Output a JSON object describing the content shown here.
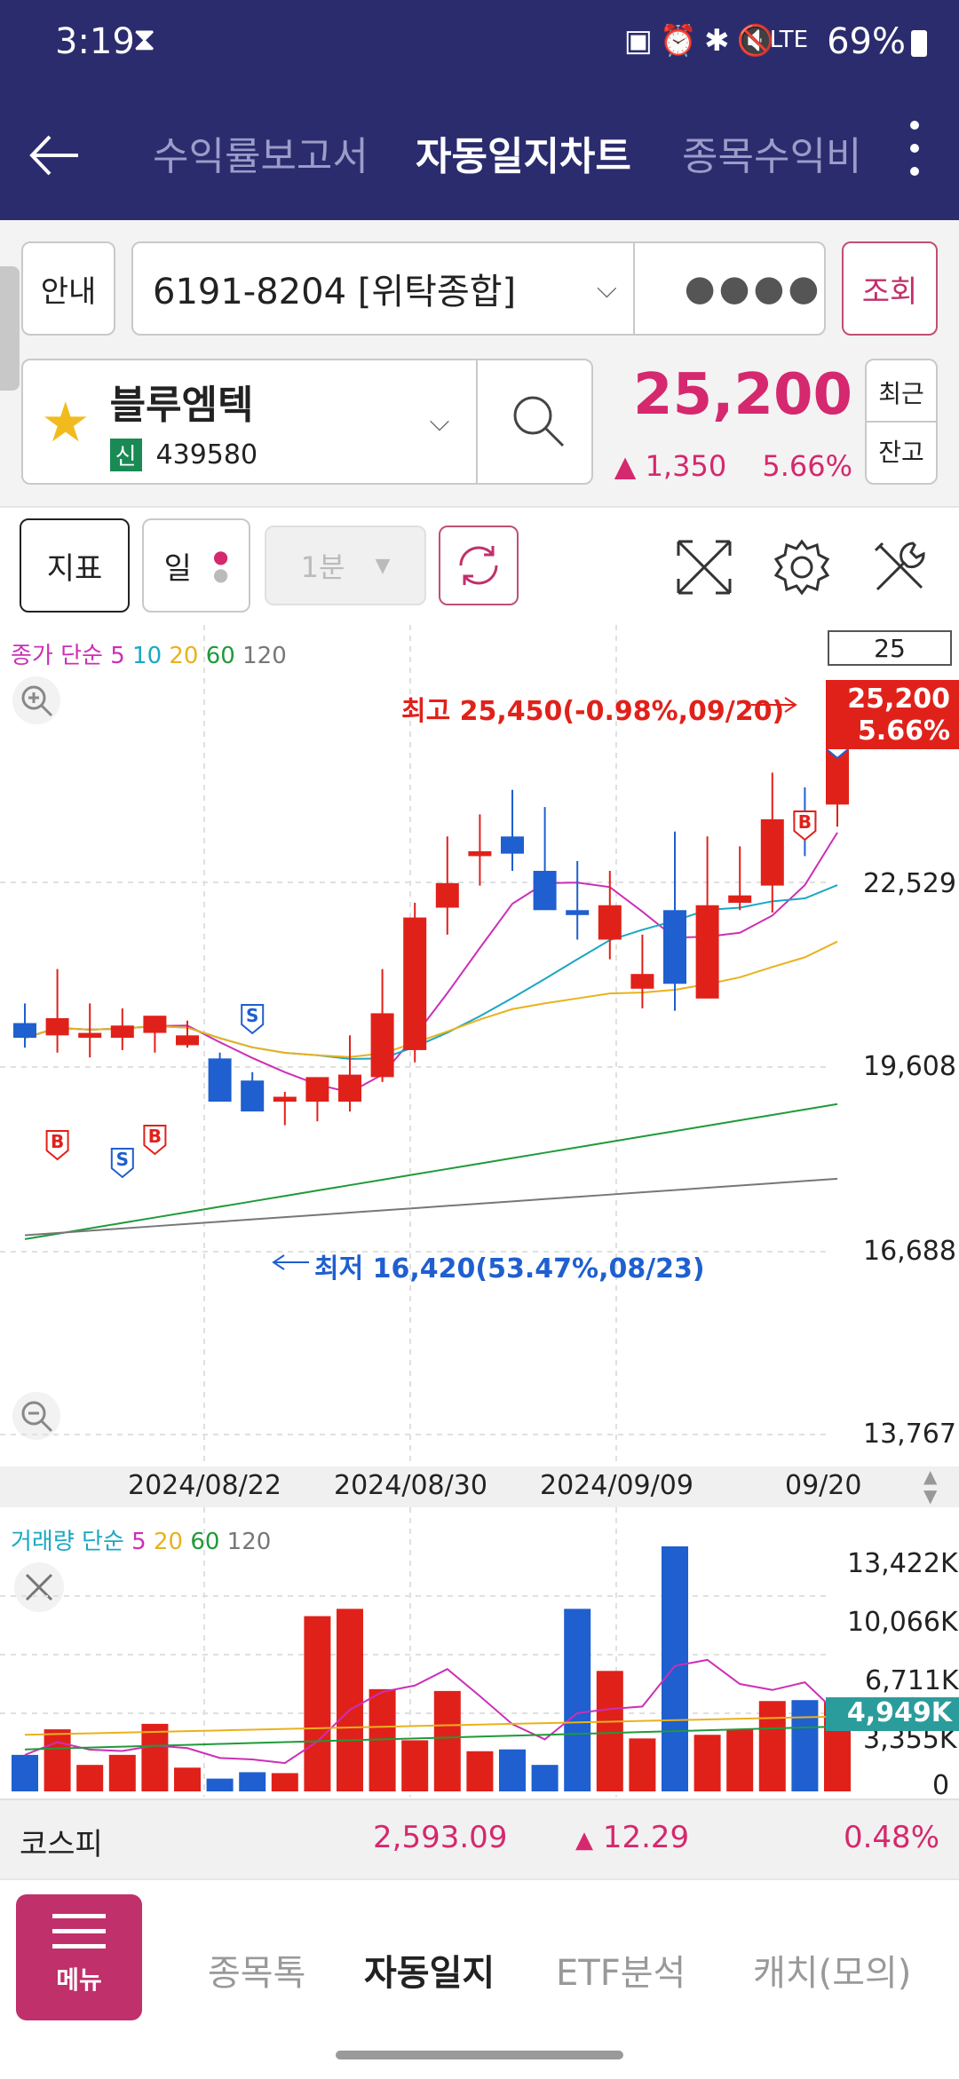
{
  "status": {
    "time": "3:19",
    "battery": "69%",
    "net": "LTE"
  },
  "header": {
    "tabs": [
      "수익률보고서",
      "자동일지차트",
      "종목수익비"
    ],
    "active": 1
  },
  "account": {
    "info_button": "안내",
    "account": "6191-8204 [위탁종합]",
    "password_mask": "●●●●",
    "query_button": "조회"
  },
  "stock": {
    "name": "블루엠텍",
    "badge": "신",
    "code": "439580",
    "price": "25,200",
    "change": "1,350",
    "change_pct": "5.66%",
    "recent_label": "최근",
    "balance_label": "잔고"
  },
  "toolbar": {
    "indicator": "지표",
    "period": "일",
    "minute": "1분"
  },
  "price_chart": {
    "legend": {
      "label": "종가 단순",
      "ma": [
        "5",
        "10",
        "20",
        "60",
        "120"
      ]
    },
    "count_box": "25",
    "current_tag": {
      "price": "25,200",
      "pct": "5.66%"
    },
    "high_note": "최고 25,450(-0.98%,09/20)",
    "low_note": "최저 16,420(53.47%,08/23)",
    "y_ticks": [
      "22,529",
      "19,608",
      "16,688",
      "13,767"
    ],
    "x_ticks": [
      "2024/08/22",
      "2024/08/30",
      "2024/09/09",
      "09/20"
    ]
  },
  "volume_chart": {
    "legend": {
      "label": "거래량 단순",
      "ma": [
        "5",
        "20",
        "60",
        "120"
      ]
    },
    "y_ticks": [
      "13,422K",
      "10,066K",
      "6,711K",
      "3,355K",
      "0"
    ],
    "current_tag": "4,949K"
  },
  "index_bar": {
    "name": "코스피",
    "value": "2,593.09",
    "change": "12.29",
    "pct": "0.48%"
  },
  "bottom_nav": {
    "menu": "메뉴",
    "items": [
      "종목톡",
      "자동일지",
      "ETF분석",
      "캐치(모의)"
    ],
    "active": 1
  },
  "colors": {
    "header": "#2b2c6e",
    "up": "#e0211a",
    "down": "#1f5fcf",
    "accent": "#d5286e",
    "ma5": "#cc2fb6",
    "ma10": "#1aa7c4",
    "ma20": "#e9b21c",
    "ma60": "#1f9a3a",
    "ma120": "#777777"
  },
  "chart_data": {
    "type": "candlestick",
    "x": [
      "08/12",
      "08/13",
      "08/14",
      "08/16",
      "08/19",
      "08/20",
      "08/21",
      "08/22",
      "08/23",
      "08/26",
      "08/27",
      "08/28",
      "08/29",
      "08/30",
      "09/02",
      "09/03",
      "09/04",
      "09/05",
      "09/06",
      "09/09",
      "09/10",
      "09/11",
      "09/12",
      "09/13",
      "09/19",
      "09/20"
    ],
    "open": [
      18500,
      18250,
      18200,
      18200,
      18300,
      18050,
      17780,
      17330,
      16900,
      16900,
      16900,
      17400,
      17950,
      20850,
      21900,
      22300,
      21600,
      20800,
      20200,
      19200,
      20800,
      19000,
      20950,
      21300,
      22800,
      22950
    ],
    "high": [
      18900,
      19600,
      18900,
      18800,
      18600,
      18550,
      17900,
      17500,
      17100,
      17250,
      18250,
      19600,
      20950,
      22300,
      22750,
      23250,
      22900,
      21800,
      21600,
      20300,
      22400,
      22300,
      22100,
      23600,
      23300,
      25450
    ],
    "low": [
      18000,
      17900,
      17800,
      17950,
      17900,
      18000,
      16950,
      16950,
      16420,
      16500,
      16700,
      17300,
      17700,
      20300,
      21300,
      21600,
      20900,
      20200,
      19800,
      18800,
      18750,
      20300,
      20800,
      20750,
      21900,
      22500
    ],
    "close": [
      18200,
      18600,
      18300,
      18450,
      18650,
      18250,
      16900,
      16700,
      17000,
      17400,
      17450,
      18700,
      20650,
      21350,
      22000,
      21950,
      20800,
      20700,
      20900,
      19500,
      19300,
      20900,
      21100,
      22650,
      22600,
      24650
    ]
  }
}
